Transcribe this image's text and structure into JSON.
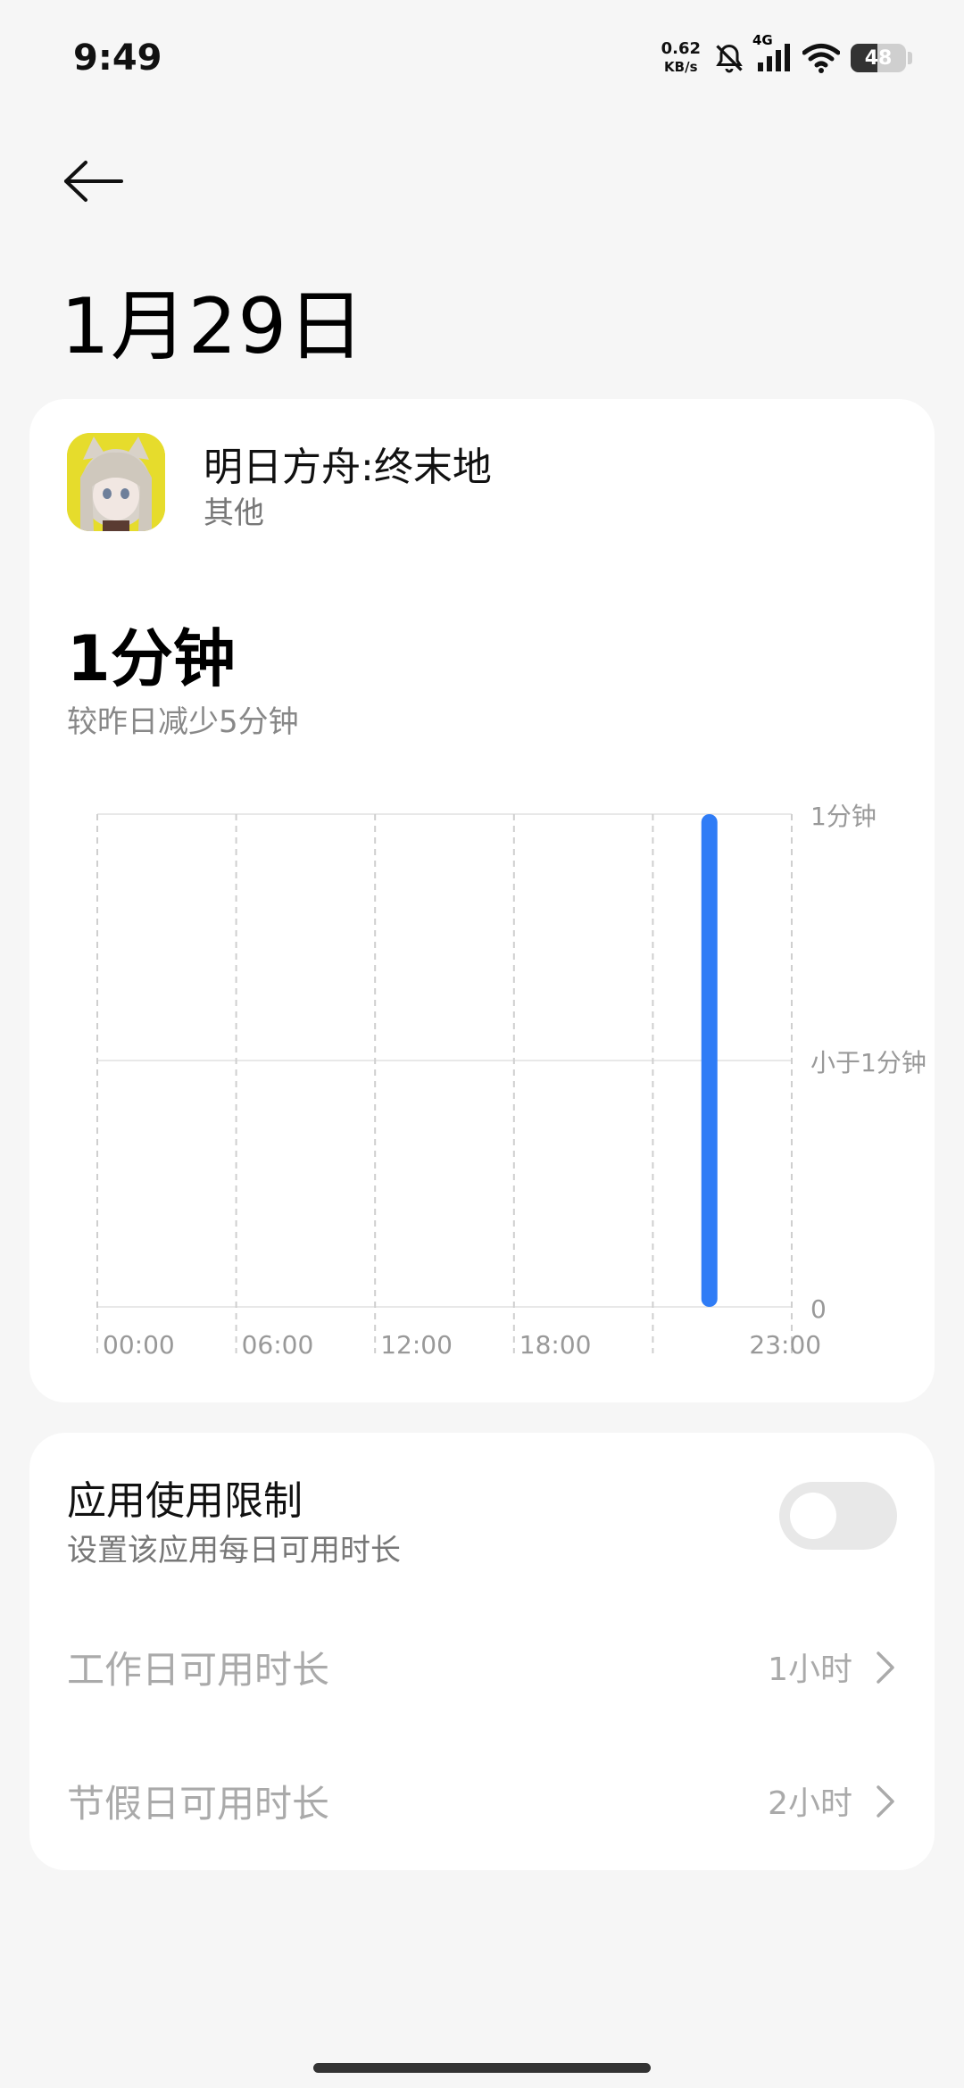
{
  "status_bar": {
    "time": "9:49",
    "net_speed_value": "0.62",
    "net_speed_unit": "KB/s",
    "network_type": "4G",
    "battery_level": "48",
    "icons": [
      "bell-off-icon",
      "signal-icon",
      "wifi-icon",
      "battery-icon"
    ]
  },
  "header": {
    "back_icon": "arrow-left-icon",
    "title": "1月29日"
  },
  "app": {
    "name": "明日方舟:终末地",
    "category": "其他"
  },
  "usage": {
    "total": "1分钟",
    "comparison": "较昨日减少5分钟"
  },
  "chart_data": {
    "type": "bar",
    "x_tick_labels": [
      "00:00",
      "06:00",
      "12:00",
      "18:00",
      "23:00"
    ],
    "y_tick_labels": [
      "1分钟",
      "小于1分钟",
      "0"
    ],
    "bars": [
      {
        "hour": 21,
        "value": 1
      }
    ],
    "y_unit_max": 1,
    "bar_color": "#2f7cf6"
  },
  "limit": {
    "title": "应用使用限制",
    "subtitle": "设置该应用每日可用时长",
    "enabled": false,
    "rows": [
      {
        "label": "工作日可用时长",
        "value": "1小时"
      },
      {
        "label": "节假日可用时长",
        "value": "2小时"
      }
    ]
  }
}
